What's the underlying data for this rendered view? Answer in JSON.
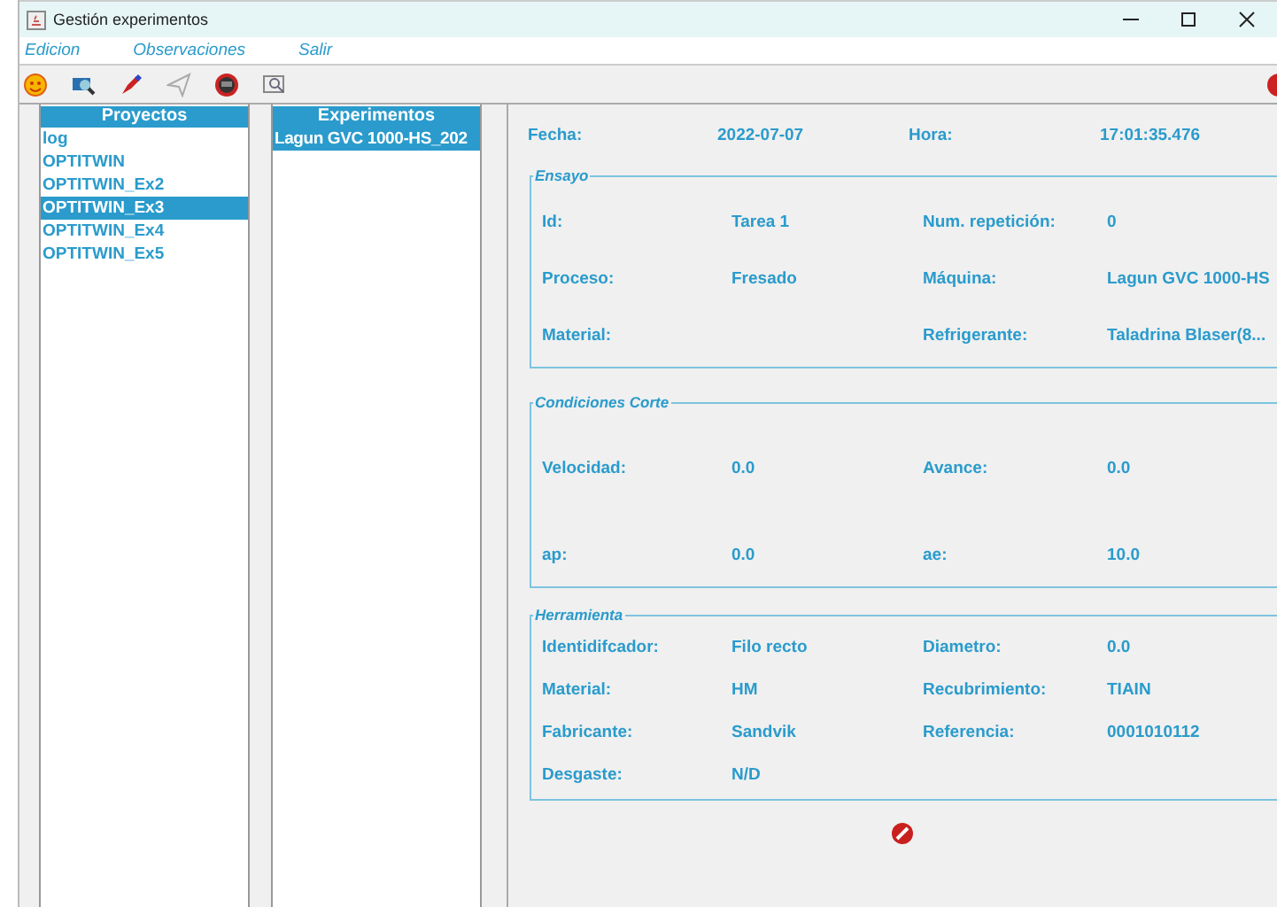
{
  "window": {
    "title": "Gestión experimentos"
  },
  "menu": [
    {
      "label": "Edicion"
    },
    {
      "label": "Observaciones"
    },
    {
      "label": "Salir"
    }
  ],
  "projects": {
    "header": "Proyectos",
    "items": [
      {
        "label": "log",
        "selected": false
      },
      {
        "label": "OPTITWIN",
        "selected": false
      },
      {
        "label": "OPTITWIN_Ex2",
        "selected": false
      },
      {
        "label": "OPTITWIN_Ex3",
        "selected": true
      },
      {
        "label": "OPTITWIN_Ex4",
        "selected": false
      },
      {
        "label": "OPTITWIN_Ex5",
        "selected": false
      }
    ]
  },
  "experiments": {
    "header": "Experimentos",
    "items": [
      {
        "label": "Lagun GVC 1000-HS_202",
        "selected": true
      }
    ]
  },
  "detail": {
    "top": [
      {
        "label": "Fecha:",
        "value": "2022-07-07"
      },
      {
        "label": "Hora:",
        "value": "17:01:35.476"
      }
    ],
    "groups": [
      {
        "title": "Ensayo",
        "rows": [
          [
            {
              "label": "Id:",
              "value": "Tarea 1"
            },
            {
              "label": "Num. repetición:",
              "value": "0"
            }
          ],
          [
            {
              "label": "Proceso:",
              "value": "Fresado"
            },
            {
              "label": "Máquina:",
              "value": "Lagun GVC 1000-HS"
            }
          ],
          [
            {
              "label": "Material:"
            },
            {
              "label": "Refrigerante:",
              "value": "Taladrina Blaser(8..."
            }
          ]
        ]
      },
      {
        "title": "Condiciones Corte",
        "rows": [
          [
            {
              "label": "Velocidad:",
              "value": "0.0"
            },
            {
              "label": "Avance:",
              "value": "0.0"
            }
          ],
          [
            {
              "label": "ap:",
              "value": "0.0"
            },
            {
              "label": "ae:",
              "value": "10.0"
            }
          ]
        ]
      },
      {
        "title": "Herramienta",
        "rows": [
          [
            {
              "label": "Identidifcador:",
              "value": "Filo recto"
            },
            {
              "label": "Diametro:",
              "value": "0.0"
            }
          ],
          [
            {
              "label": "Material:",
              "value": "HM"
            },
            {
              "label": "Recubrimiento:",
              "value": "TIAIN"
            }
          ],
          [
            {
              "label": "Fabricante:",
              "value": "Sandvik"
            },
            {
              "label": "Referencia:",
              "value": "0001010112"
            }
          ],
          [
            {
              "label": "Desgaste:",
              "value": "N/D"
            }
          ]
        ]
      }
    ]
  }
}
